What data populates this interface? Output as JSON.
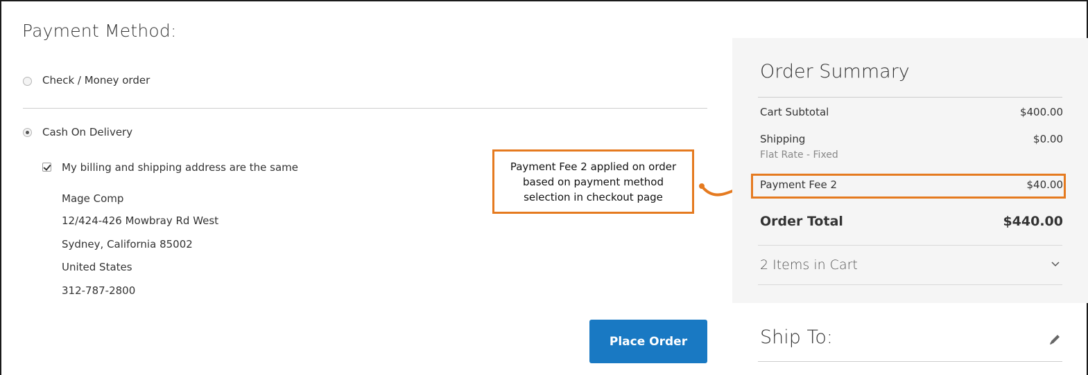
{
  "payment": {
    "title": "Payment Method:",
    "options": [
      {
        "label": "Check / Money order",
        "selected": false
      },
      {
        "label": "Cash On Delivery",
        "selected": true
      }
    ],
    "same_address_label": "My billing and shipping address are the same",
    "same_address_checked": true,
    "address": {
      "name": "Mage Comp",
      "street": "12/424-426 Mowbray Rd West",
      "city_line": "Sydney, California 85002",
      "country": "United States",
      "phone": "312-787-2800"
    },
    "place_order_label": "Place Order"
  },
  "callout": {
    "line1": "Payment Fee 2 applied on order",
    "line2": "based on payment method",
    "line3": "selection in checkout page"
  },
  "summary": {
    "title": "Order Summary",
    "subtotal_label": "Cart Subtotal",
    "subtotal_value": "$400.00",
    "shipping_label": "Shipping",
    "shipping_method": "Flat Rate - Fixed",
    "shipping_value": "$0.00",
    "fee_label": "Payment Fee 2",
    "fee_value": "$40.00",
    "total_label": "Order Total",
    "total_value": "$440.00",
    "items_label": "2 Items in Cart",
    "items_icon": "chevron-down-icon"
  },
  "ship_to": {
    "title": "Ship To:",
    "edit_icon": "pencil-icon"
  },
  "colors": {
    "accent": "#1979c3",
    "highlight": "#e57a1f",
    "summary_bg": "#f5f5f5"
  }
}
